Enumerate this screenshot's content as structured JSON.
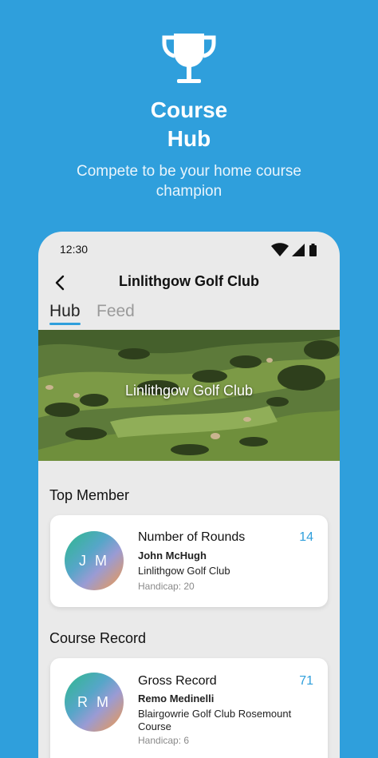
{
  "promo": {
    "title_line1": "Course",
    "title_line2": "Hub",
    "subtitle": "Compete to be your home course champion",
    "icon": "trophy-icon"
  },
  "status_bar": {
    "time": "12:30",
    "icons": [
      "wifi-icon",
      "signal-icon",
      "battery-icon"
    ]
  },
  "app_bar": {
    "back_icon": "back-arrow-icon",
    "title": "Linlithgow Golf Club"
  },
  "tabs": [
    {
      "label": "Hub",
      "selected": true
    },
    {
      "label": "Feed",
      "selected": false
    }
  ],
  "banner": {
    "label": "Linlithgow Golf Club"
  },
  "top_member": {
    "section_title": "Top Member",
    "initials": "J M",
    "metric": "Number of Rounds",
    "value": "14",
    "name": "John McHugh",
    "club": "Linlithgow Golf Club",
    "handicap": "Handicap: 20"
  },
  "course_record": {
    "section_title": "Course Record",
    "initials": "R M",
    "metric": "Gross Record",
    "value": "71",
    "name": "Remo Medinelli",
    "club": "Blairgowrie Golf Club Rosemount Course",
    "handicap": "Handicap: 6"
  },
  "colors": {
    "background": "#2f9fdc",
    "accent": "#2f9fdc",
    "phone_bg": "#eaeaea"
  }
}
